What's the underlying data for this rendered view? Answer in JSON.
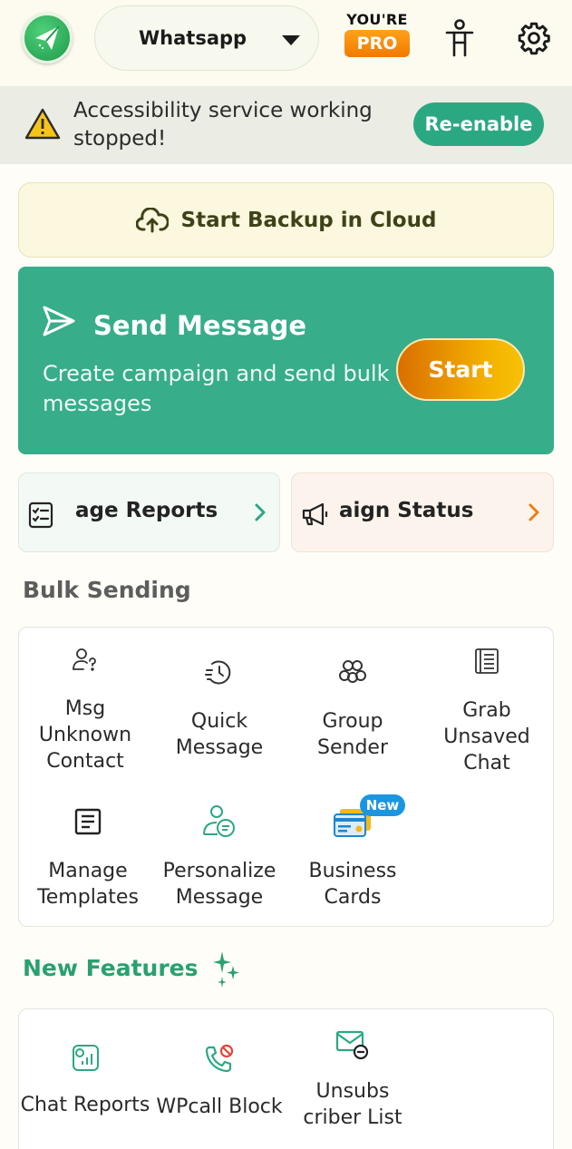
{
  "header": {
    "app_selector": "Whatsapp",
    "pro_line1": "YOU'RE",
    "pro_badge": "PRO"
  },
  "alert": {
    "message": "Accessibility service working stopped!",
    "action": "Re-enable"
  },
  "backup": {
    "label": "Start Backup in Cloud"
  },
  "send_message": {
    "title": "Send Message",
    "subtitle": "Create campaign and send bulk messages",
    "start": "Start"
  },
  "reports": [
    {
      "label": "age Reports",
      "icon": "report-list-icon"
    },
    {
      "label": "aign Status",
      "icon": "megaphone-icon"
    }
  ],
  "bulk_sending": {
    "title": "Bulk Sending",
    "items": [
      {
        "label": "Msg Unknown Contact",
        "icon": "unknown-contact-icon"
      },
      {
        "label": "Quick Message",
        "icon": "quick-message-icon"
      },
      {
        "label": "Group Sender",
        "icon": "group-icon"
      },
      {
        "label": "Grab Unsaved Chat",
        "icon": "unsaved-chat-icon"
      },
      {
        "label": "Manage Templates",
        "icon": "template-icon"
      },
      {
        "label": "Personalize Message",
        "icon": "personalize-icon"
      },
      {
        "label": "Business Cards",
        "icon": "business-card-icon"
      }
    ],
    "new_badge": "New"
  },
  "new_features": {
    "title": "New Features",
    "items": [
      {
        "label": "Chat Reports",
        "icon": "chat-report-icon"
      },
      {
        "label": "WPcall Block",
        "icon": "call-block-icon"
      },
      {
        "label": "Unsubs criber List",
        "icon": "unsubscribe-icon"
      }
    ]
  },
  "colors": {
    "accent_green": "#37ad8a",
    "pro_orange": "#f17a00",
    "new_blue": "#1a96e0",
    "feature_green": "#2aa06e"
  }
}
